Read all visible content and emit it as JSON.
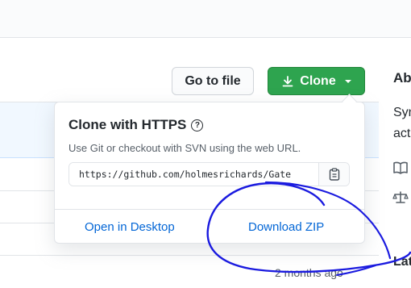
{
  "toolbar": {
    "goto_file_label": "Go to file",
    "clone_label": "Clone"
  },
  "clone_popover": {
    "title": "Clone with HTTPS",
    "description": "Use Git or checkout with SVN using the web URL.",
    "url_value": "https://github.com/holmesrichards/Gate",
    "open_desktop_label": "Open in Desktop",
    "download_zip_label": "Download ZIP"
  },
  "sidebar": {
    "about_heading": "Abo",
    "desc_line1": "Syn",
    "desc_line2": "act",
    "latest_heading": "Lat"
  },
  "file_list": {
    "last_commit_time": "2 months ago"
  },
  "icons": {
    "download": "download-icon",
    "help": "question-circle-icon",
    "clipboard": "clipboard-icon",
    "book": "book-icon",
    "scale": "law-icon"
  },
  "colors": {
    "clone_button": "#2ea44f",
    "link": "#0366d6",
    "annotation_ink": "#1a1adf"
  }
}
